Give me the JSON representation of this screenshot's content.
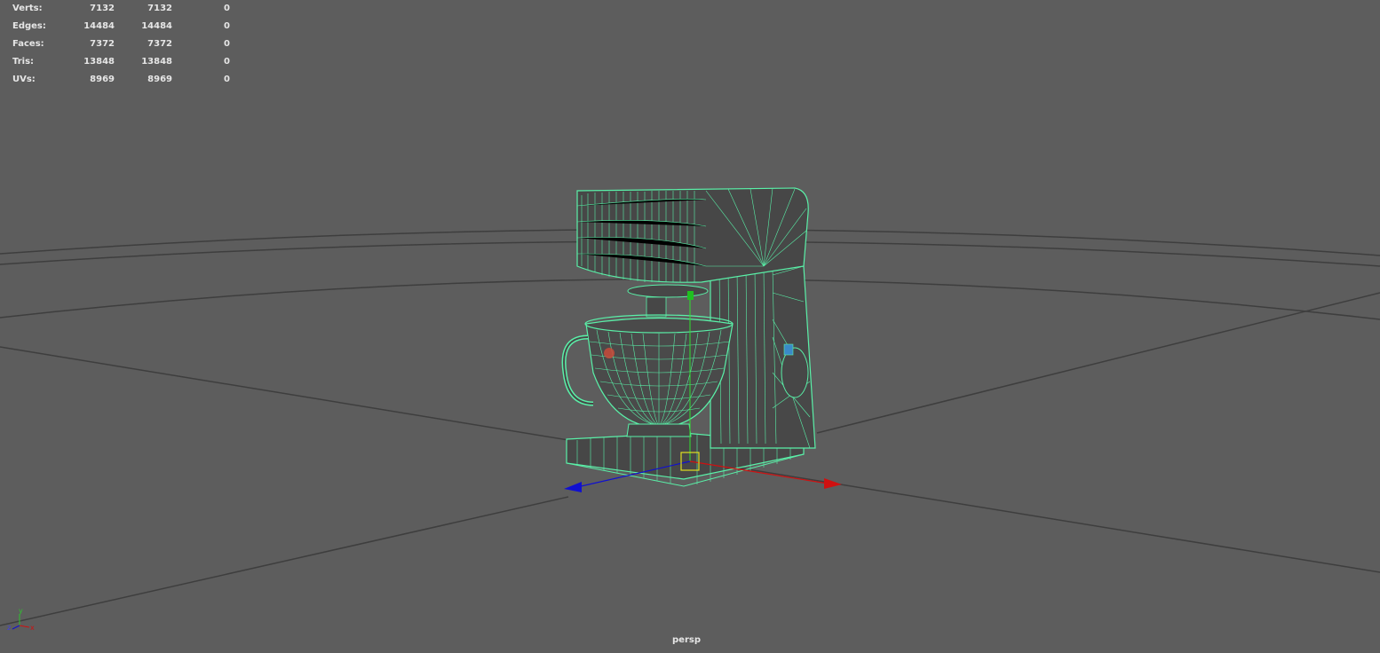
{
  "hud": {
    "rows": [
      {
        "label": "Verts:",
        "v1": "7132",
        "v2": "7132",
        "v3": "0"
      },
      {
        "label": "Edges:",
        "v1": "14484",
        "v2": "14484",
        "v3": "0"
      },
      {
        "label": "Faces:",
        "v1": "7372",
        "v2": "7372",
        "v3": "0"
      },
      {
        "label": "Tris:",
        "v1": "13848",
        "v2": "13848",
        "v3": "0"
      },
      {
        "label": "UVs:",
        "v1": "8969",
        "v2": "8969",
        "v3": "0"
      }
    ]
  },
  "viewport": {
    "camera": "persp",
    "axis_labels": {
      "x": "x",
      "y": "y",
      "z": "z"
    }
  },
  "colors": {
    "background": "#5d5d5d",
    "grid": "#3a3a3a",
    "wireframe": "#5af0a8",
    "axis_x": "#d01010",
    "axis_y": "#10c010",
    "axis_z": "#1010d0",
    "pivot": "#e0e020"
  },
  "model": {
    "name": "stand-mixer",
    "display": "wireframe-on-shaded"
  }
}
